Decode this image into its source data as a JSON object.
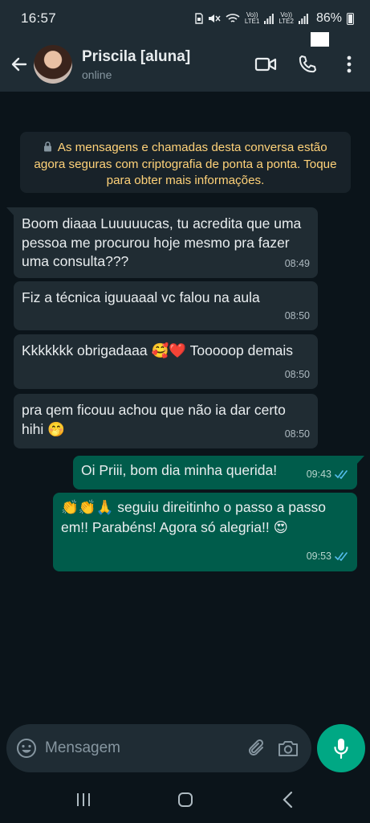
{
  "status_bar": {
    "time": "16:57",
    "lte1": "LTE1",
    "lte2": "LTE2",
    "vol1": "Vo))",
    "vol2": "Vo))",
    "battery": "86%"
  },
  "header": {
    "contact_name": "Priscila [aluna]",
    "contact_status": "online",
    "icons": [
      "back-arrow-icon",
      "video-call-icon",
      "voice-call-icon",
      "more-options-icon"
    ]
  },
  "encryption_notice": {
    "text": "As mensagens e chamadas desta conversa estão agora seguras com criptografia de ponta a ponta. Toque para obter mais informações.",
    "color": "#ffd279"
  },
  "messages": [
    {
      "direction": "in",
      "text": "Boom diaaa Luuuuucas, tu acredita que uma pessoa me procurou hoje mesmo pra fazer uma consulta???",
      "time": "08:49"
    },
    {
      "direction": "in",
      "text": "Fiz a técnica iguuaaal vc falou na aula",
      "time": "08:50"
    },
    {
      "direction": "in",
      "text": "Kkkkkkk obrigadaaa 🥰❤️ Tooooop demais",
      "time": "08:50"
    },
    {
      "direction": "in",
      "text": "pra qem ficouu achou que não ia dar certo hihi 🤭",
      "time": "08:50"
    },
    {
      "direction": "out",
      "text": "Oi Priii, bom dia minha querida!",
      "time": "09:43",
      "status": "read"
    },
    {
      "direction": "out",
      "text": "👏👏🙏 seguiu direitinho o passo a passo em!! Parabéns! Agora só alegria!! 😍",
      "time": "09:53",
      "status": "read"
    }
  ],
  "composer": {
    "placeholder": "Mensagem",
    "value": ""
  },
  "colors": {
    "background": "#0b141a",
    "header": "#1f2c34",
    "incoming_bubble": "#202c33",
    "outgoing_bubble": "#005c4b",
    "accent": "#00a884",
    "read_ticks": "#53bdeb"
  }
}
